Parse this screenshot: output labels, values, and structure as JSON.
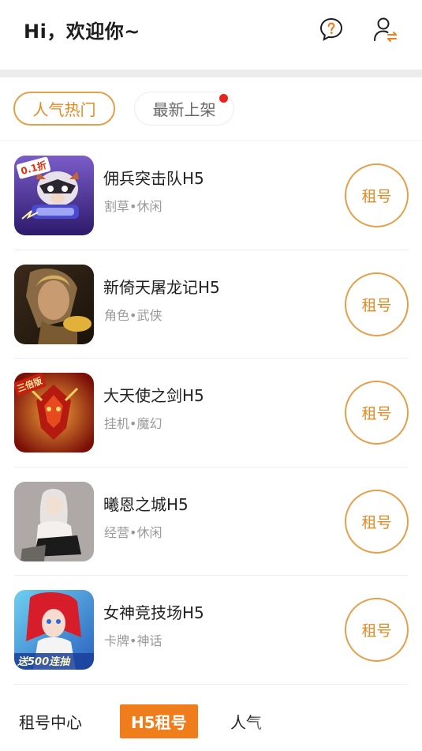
{
  "header": {
    "greeting": "Hi，欢迎你~",
    "help_icon": "help-question-icon",
    "user_icon": "user-switch-icon"
  },
  "tabs": [
    {
      "label": "人气热门",
      "active": true
    },
    {
      "label": "最新上架",
      "active": false,
      "has_dot": true
    }
  ],
  "games": [
    {
      "title": "佣兵突击队H5",
      "tags": "割草•休闲",
      "action": "租号",
      "badge": "0.1折"
    },
    {
      "title": "新倚天屠龙记H5",
      "tags": "角色•武侠",
      "action": "租号"
    },
    {
      "title": "大天使之剑H5",
      "tags": "挂机•魔幻",
      "action": "租号",
      "badge": "三倍版"
    },
    {
      "title": "曦恩之城H5",
      "tags": "经营•休闲",
      "action": "租号"
    },
    {
      "title": "女神竞技场H5",
      "tags": "卡牌•神话",
      "action": "租号",
      "badge": "送500连抽"
    }
  ],
  "bottom_nav": {
    "items": [
      "租号中心",
      "H5租号",
      "人气"
    ],
    "active_index": 1
  },
  "colors": {
    "accent": "#e08a24",
    "accent_fill": "#f07d1c",
    "dot": "#e8231a"
  }
}
